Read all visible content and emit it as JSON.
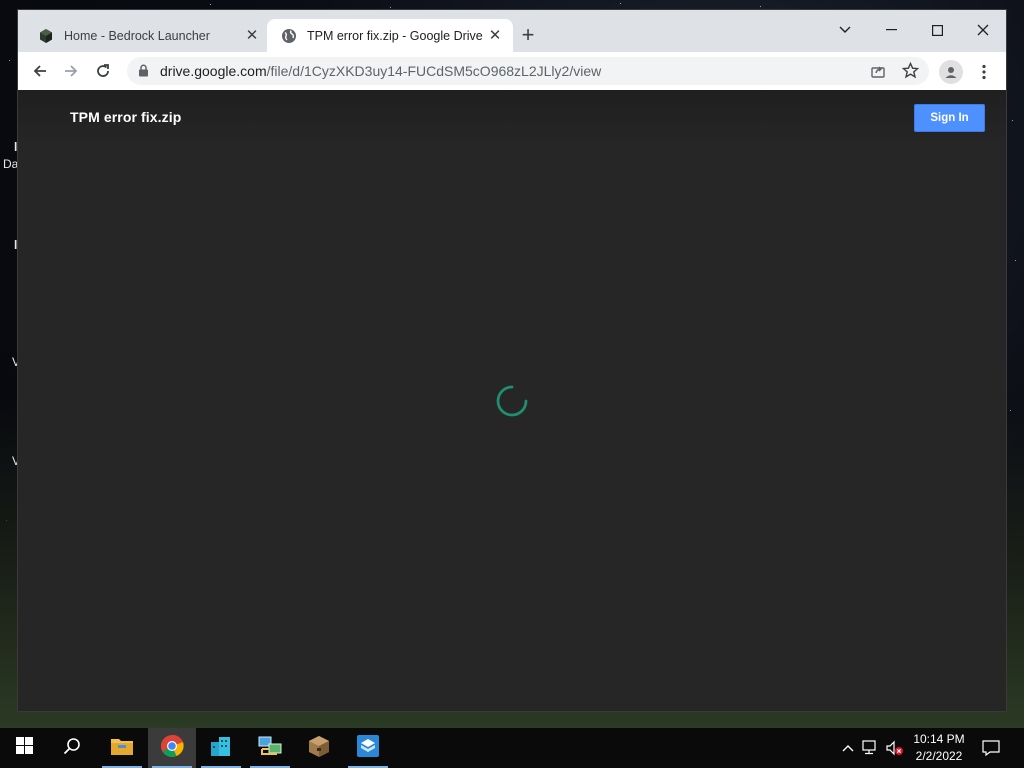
{
  "desktop": {
    "label_da": "Da",
    "label_l1": "l",
    "label_l2": "l",
    "label_v1": "V",
    "label_v2": "V"
  },
  "browser": {
    "tabs": [
      {
        "title": "Home - Bedrock Launcher",
        "icon": "bedrock-cube-icon",
        "active": false
      },
      {
        "title": "TPM error fix.zip - Google Drive",
        "icon": "globe-icon",
        "active": true
      }
    ],
    "url": {
      "host": "drive.google.com",
      "path": "/file/d/1CyzXKD3uy14-FUCdSM5cO968zL2JLly2/view"
    }
  },
  "page": {
    "title": "TPM error fix.zip",
    "sign_in_label": "Sign In",
    "spinner_color": "#1e8e6e"
  },
  "taskbar": {
    "pinned": [
      "start-icon",
      "search-icon",
      "file-explorer-icon",
      "chrome-icon",
      "buildings-icon",
      "network-computers-icon",
      "package-icon",
      "box-app-icon"
    ],
    "clock_time": "10:14 PM",
    "clock_date": "2/2/2022"
  },
  "colors": {
    "accent_blue": "#4d90fe",
    "page_bg": "#262626",
    "tab_strip": "#dee1e6"
  }
}
